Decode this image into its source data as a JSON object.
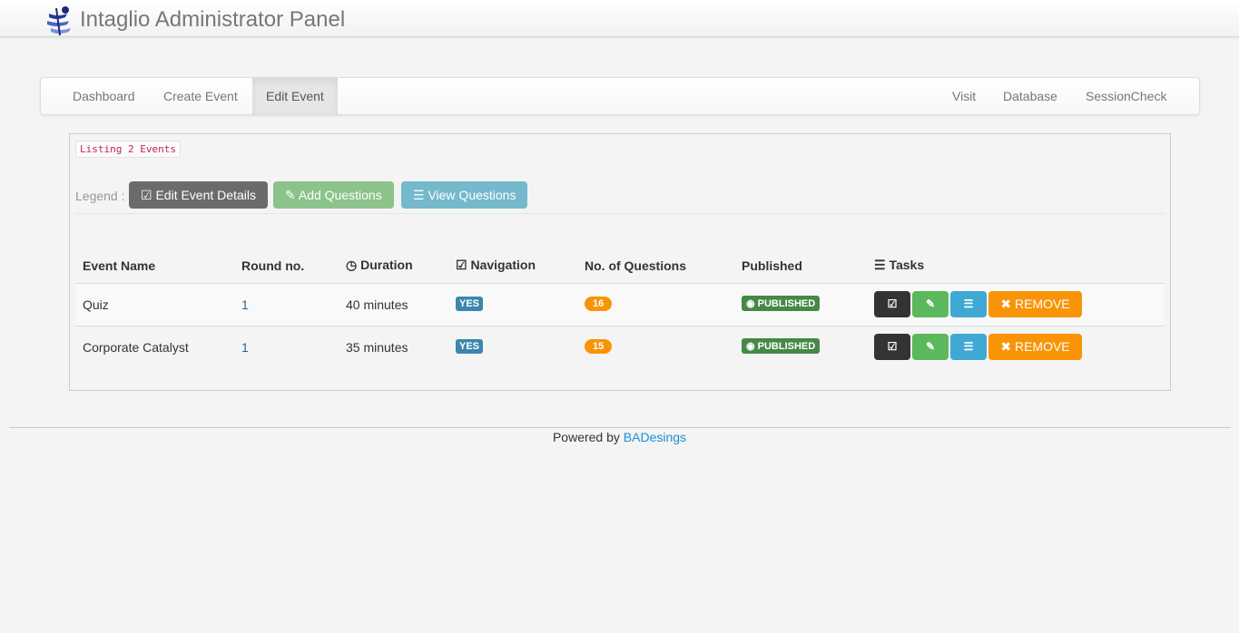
{
  "header": {
    "title": "Intaglio Administrator Panel"
  },
  "nav": {
    "left": [
      "Dashboard",
      "Create Event",
      "Edit Event"
    ],
    "right": [
      "Visit",
      "Database",
      "SessionCheck"
    ],
    "active": "Edit Event"
  },
  "listing": "Listing 2 Events",
  "legend": {
    "label": "Legend :",
    "edit": "Edit Event Details",
    "add": "Add Questions",
    "view": "View Questions"
  },
  "table": {
    "headers": [
      "Event Name",
      "Round no.",
      "Duration",
      "Navigation",
      "No. of Questions",
      "Published",
      "Tasks"
    ],
    "rows": [
      {
        "name": "Quiz",
        "round": "1",
        "duration": "40 minutes",
        "navigation": "YES",
        "questions": "16",
        "published": "PUBLISHED",
        "remove": "REMOVE"
      },
      {
        "name": "Corporate Catalyst",
        "round": "1",
        "duration": "35 minutes",
        "navigation": "YES",
        "questions": "15",
        "published": "PUBLISHED",
        "remove": "REMOVE"
      }
    ]
  },
  "footer": {
    "text": "Powered by",
    "link": "BADesings"
  },
  "colors": {
    "dark": "#6b6b6b",
    "green": "#8bc38b",
    "blue": "#74b9cc",
    "orange": "#f89406",
    "published": "#468847",
    "navy": "#3a87ad"
  }
}
